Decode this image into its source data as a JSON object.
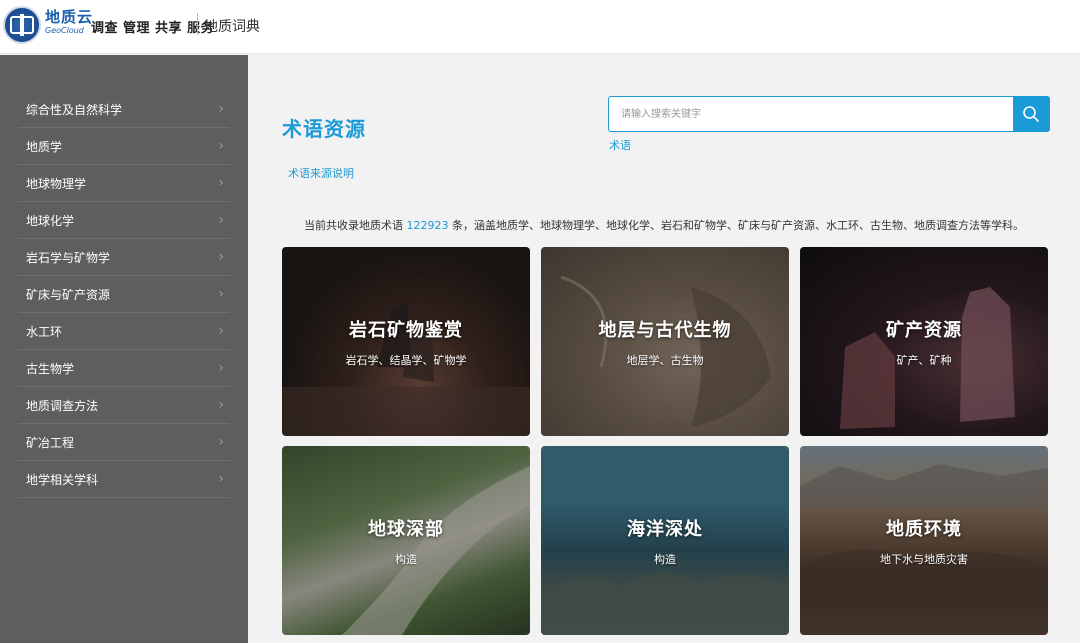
{
  "header": {
    "brand_name": "地质云",
    "brand_sub": "GeoCloud",
    "nav_main": "调查 管理 共享 服务",
    "nav_dict": "地质词典"
  },
  "sidebar": {
    "items": [
      {
        "label": "综合性及自然科学"
      },
      {
        "label": "地质学"
      },
      {
        "label": "地球物理学"
      },
      {
        "label": "地球化学"
      },
      {
        "label": "岩石学与矿物学"
      },
      {
        "label": "矿床与矿产资源"
      },
      {
        "label": "水工环"
      },
      {
        "label": "古生物学"
      },
      {
        "label": "地质调查方法"
      },
      {
        "label": "矿冶工程"
      },
      {
        "label": "地学相关学科"
      }
    ],
    "chevron": "›"
  },
  "main": {
    "title": "术语资源",
    "source_link": "术语来源说明",
    "search": {
      "placeholder": "请输入搜索关键字",
      "value": "",
      "tag": "术语"
    },
    "summary": {
      "prefix": "当前共收录地质术语 ",
      "count": "122923",
      "suffix": " 条，涵盖地质学、地球物理学、地球化学、岩石和矿物学、矿床与矿产资源、水工环、古生物、地质调查方法等学科。"
    },
    "cards": [
      {
        "title": "岩石矿物鉴赏",
        "sub": "岩石学、结晶学、矿物学"
      },
      {
        "title": "地层与古代生物",
        "sub": "地层学、古生物"
      },
      {
        "title": "矿产资源",
        "sub": "矿产、矿种"
      },
      {
        "title": "地球深部",
        "sub": "构造"
      },
      {
        "title": "海洋深处",
        "sub": "构造"
      },
      {
        "title": "地质环境",
        "sub": "地下水与地质灾害"
      }
    ]
  },
  "colors": {
    "accent": "#1a9ad6",
    "sidebar_bg": "#5e5e5e",
    "page_bg": "#f2f2f2"
  }
}
